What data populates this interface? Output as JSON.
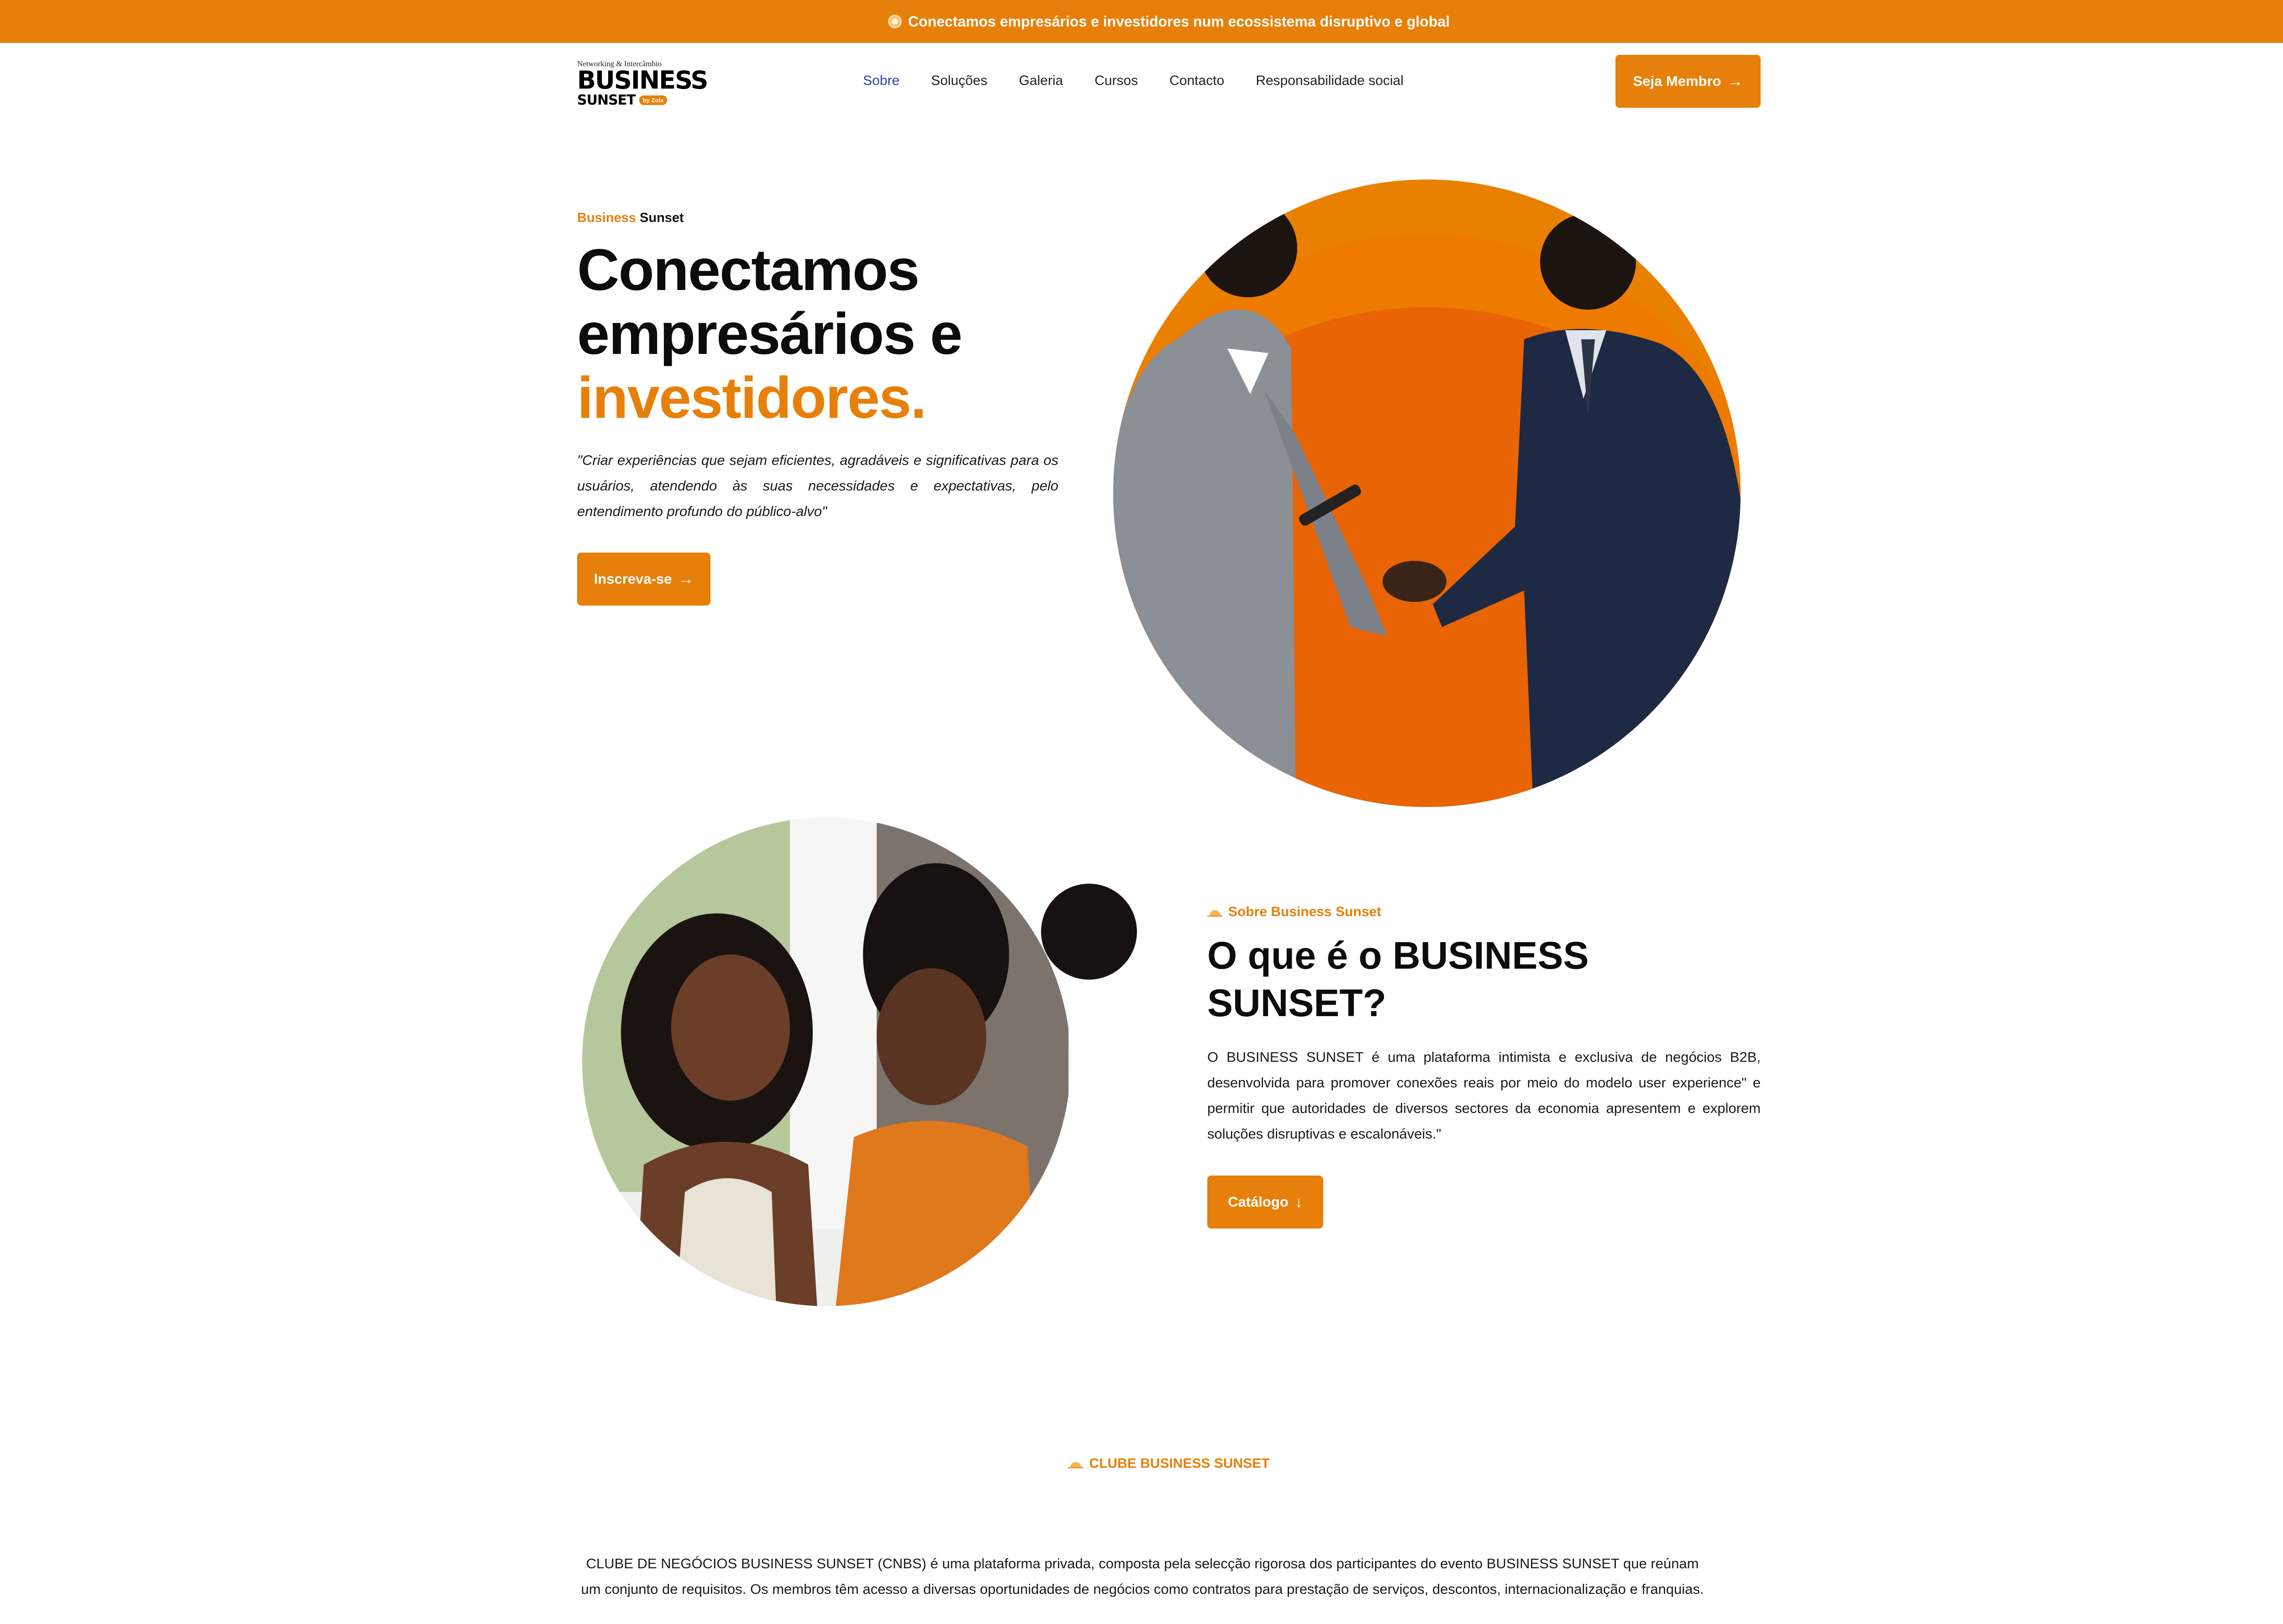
{
  "announcement": {
    "text": "Conectamos empresários e investidores num ecossistema disruptivo e global"
  },
  "logo": {
    "tagline": "Networking & Intercâmbio",
    "line1": "BUSINESS",
    "line2": "SUNSET",
    "badge": "by Zola"
  },
  "nav": {
    "items": [
      "Sobre",
      "Soluções",
      "Galeria",
      "Cursos",
      "Contacto",
      "Responsabilidade social"
    ],
    "active": "Sobre"
  },
  "header": {
    "cta_label": "Seja Membro",
    "cta_icon": "arrow-right-icon"
  },
  "hero": {
    "eyebrow_a": "Business",
    "eyebrow_b": "Sunset",
    "title_line1": "Conectamos",
    "title_line2": "empresários e",
    "title_highlight": "investidores.",
    "quote": "\"Criar experiências que sejam eficientes, agradáveis e significativas para os usuários, atendendo às suas necessidades e expectativas, pelo entendimento profundo do público-alvo\"",
    "cta_label": "Inscreva-se",
    "cta_icon": "arrow-right-icon",
    "image": "two businessmen shaking hands in front of orange circle"
  },
  "about": {
    "eyebrow": "Sobre Business Sunset",
    "title": "O que é o BUSINESS SUNSET?",
    "body": "O BUSINESS SUNSET é uma plataforma intimista e exclusiva de negócios B2B, desenvolvida para promover conexões reais por meio do modelo user experience\" e permitir que autoridades de diversos sectores da economia apresentem e explorem soluções disruptivas e escalonáveis.\"",
    "cta_label": "Catálogo",
    "cta_icon": "arrow-down-icon",
    "image": "two smiling women in conversation"
  },
  "club": {
    "eyebrow": "CLUBE BUSINESS SUNSET",
    "body": "CLUBE DE NEGÓCIOS BUSINESS SUNSET (CNBS) é uma plataforma privada, composta pela selecção rigorosa dos participantes do evento BUSINESS SUNSET que reúnam um conjunto de requisitos. Os membros têm acesso a diversas oportunidades de negócios como contratos para prestação de serviços, descontos, internacionalização e franquias."
  },
  "colors": {
    "accent": "#E7800A",
    "nav_active": "#2A43A8",
    "text": "#111111"
  }
}
